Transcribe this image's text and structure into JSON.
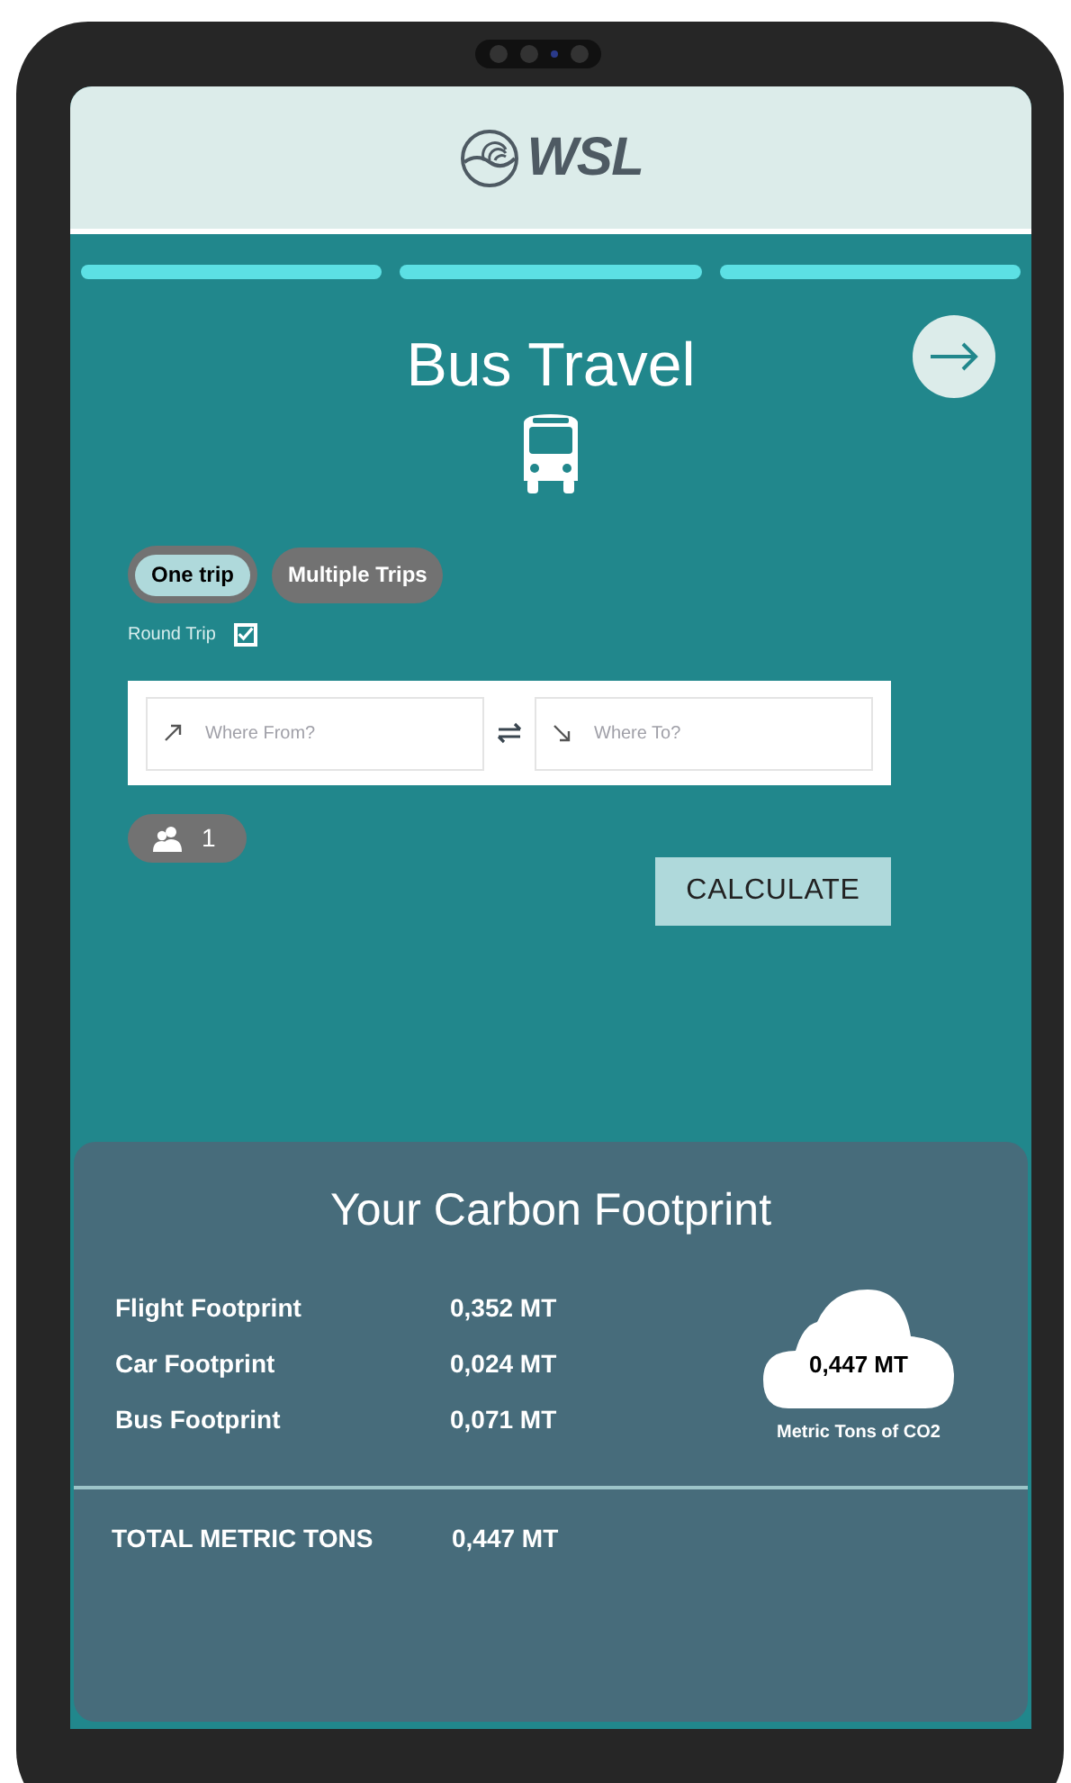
{
  "header": {
    "logo_text": "WSL"
  },
  "steps": [
    {
      "done": true
    },
    {
      "done": true
    },
    {
      "done": true
    }
  ],
  "title": "Bus Travel",
  "trip_types": [
    {
      "label": "One trip",
      "selected": true
    },
    {
      "label": "Multiple Trips",
      "selected": false
    }
  ],
  "round_trip": {
    "label": "Round Trip",
    "checked": true
  },
  "from_field": {
    "placeholder": "Where From?"
  },
  "to_field": {
    "placeholder": "Where To?"
  },
  "passengers": "1",
  "calculate_button": "CALCULATE",
  "footprint": {
    "title": "Your Carbon Footprint",
    "rows": [
      {
        "label": "Flight Footprint",
        "value": "0,352 MT"
      },
      {
        "label": "Car Footprint",
        "value": "0,024 MT"
      },
      {
        "label": "Bus Footprint",
        "value": "0,071 MT"
      }
    ],
    "cloud_value": "0,447 MT",
    "cloud_caption": "Metric Tons of CO2",
    "total_label": "TOTAL METRIC TONS",
    "total_value": "0,447 MT"
  }
}
